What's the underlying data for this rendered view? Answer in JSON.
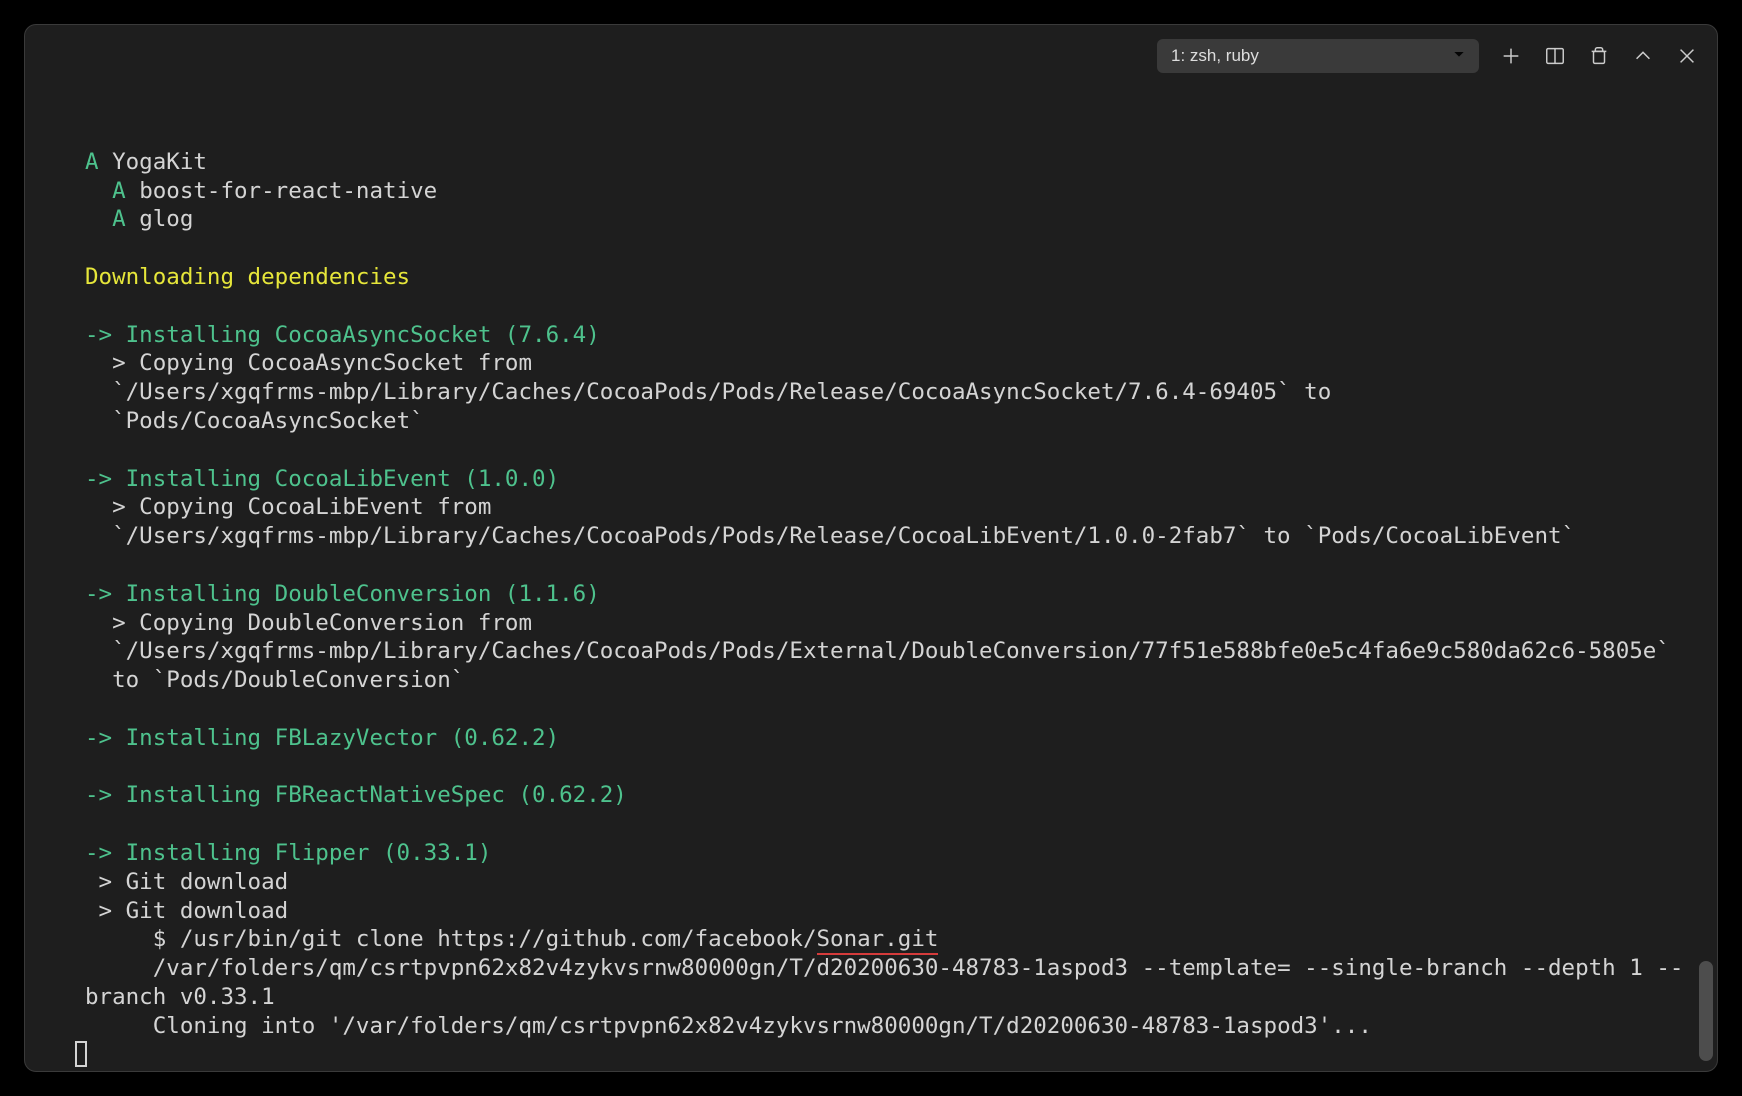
{
  "toolbar": {
    "dropdown_label": "1: zsh, ruby"
  },
  "added": {
    "prefix": "A ",
    "items": [
      "YogaKit",
      "boost-for-react-native",
      "glog"
    ]
  },
  "header_downloading": "Downloading dependencies",
  "installs": {
    "cocoa_async": {
      "line": "-> Installing CocoaAsyncSocket (7.6.4)",
      "copy_prefix": "  > Copying CocoaAsyncSocket from",
      "copy_path": "  `/Users/xgqfrms-mbp/Library/Caches/CocoaPods/Pods/Release/CocoaAsyncSocket/7.6.4-69405` to",
      "copy_dest": "  `Pods/CocoaAsyncSocket`"
    },
    "cocoa_libevent": {
      "line": "-> Installing CocoaLibEvent (1.0.0)",
      "copy_prefix": "  > Copying CocoaLibEvent from",
      "copy_path": "  `/Users/xgqfrms-mbp/Library/Caches/CocoaPods/Pods/Release/CocoaLibEvent/1.0.0-2fab7` to `Pods/CocoaLibEvent`"
    },
    "double_conv": {
      "line": "-> Installing DoubleConversion (1.1.6)",
      "copy_prefix": "  > Copying DoubleConversion from",
      "copy_path1": "  `/Users/xgqfrms-mbp/Library/Caches/CocoaPods/Pods/External/DoubleConversion/77f51e588bfe0e5c4fa6e9c580da62c6-5805e`",
      "copy_path2": "  to `Pods/DoubleConversion`"
    },
    "fblazy": {
      "line": "-> Installing FBLazyVector (0.62.2)"
    },
    "fbreact": {
      "line": "-> Installing FBReactNativeSpec (0.62.2)"
    },
    "flipper": {
      "line": "-> Installing Flipper (0.33.1)",
      "git1": " > Git download",
      "git2": " > Git download",
      "cmd_prefix": "     $ /usr/bin/git clone https://github.com/facebook/",
      "cmd_underlined": "Sonar.git",
      "cmd_line2": "     /var/folders/qm/csrtpvpn62x82v4zykvsrnw80000gn/T/d20200630-48783-1aspod3 --template= --single-branch --depth 1 --branch v0.33.1",
      "cmd_line3": "     Cloning into '/var/folders/qm/csrtpvpn62x82v4zykvsrnw80000gn/T/d20200630-48783-1aspod3'..."
    }
  }
}
